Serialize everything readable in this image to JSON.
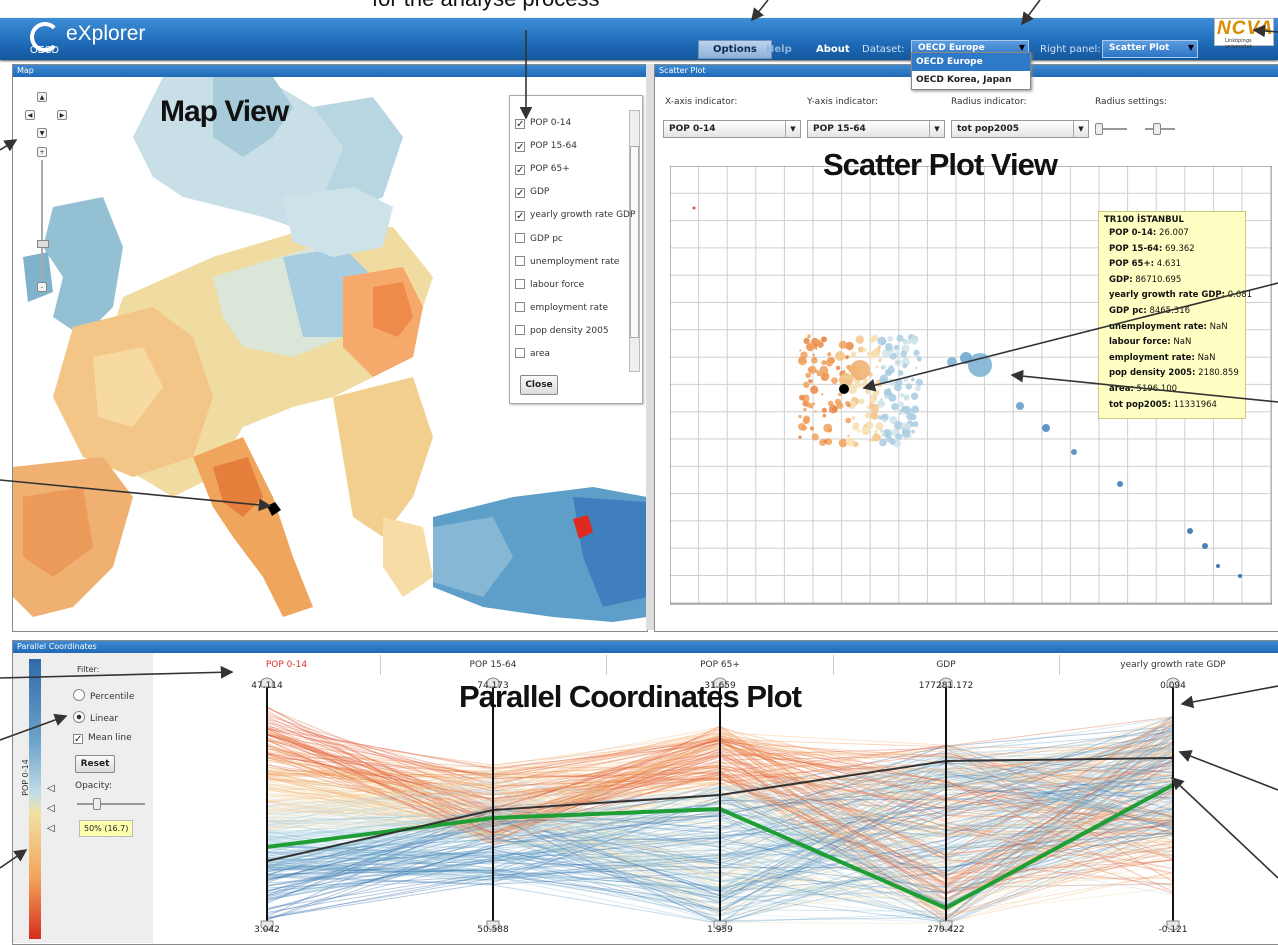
{
  "caption": "for the analyse process",
  "app": {
    "logo_text": "OECD",
    "title": "eXplorer"
  },
  "menu": {
    "options": "Options",
    "greyed": "Help",
    "about": "About",
    "dataset_label": "Dataset:",
    "dataset_value": "OECD Europe",
    "right_panel_label": "Right panel:",
    "right_panel_value": "Scatter Plot"
  },
  "dataset_options": [
    "OECD Europe",
    "OECD Korea, Japan"
  ],
  "brand": {
    "name": "NCVA",
    "subtitle": "Linköpings universitet"
  },
  "colors": {
    "accent": "#2f79c9",
    "mean_line": "#1f9e36",
    "selected_line": "#333333",
    "highlight_region": "#e02a1e"
  },
  "map": {
    "panel_title": "Map",
    "view_title": "Map View",
    "indicators": [
      {
        "label": "POP 0-14",
        "checked": true
      },
      {
        "label": "POP 15-64",
        "checked": true
      },
      {
        "label": "POP 65+",
        "checked": true
      },
      {
        "label": "GDP",
        "checked": true
      },
      {
        "label": "yearly growth rate GDP",
        "checked": true
      },
      {
        "label": "GDP pc",
        "checked": false
      },
      {
        "label": "unemployment rate",
        "checked": false
      },
      {
        "label": "labour force",
        "checked": false
      },
      {
        "label": "employment rate",
        "checked": false
      },
      {
        "label": "pop density 2005",
        "checked": false
      },
      {
        "label": "area",
        "checked": false
      }
    ],
    "close_label": "Close",
    "zoom_in": "+",
    "zoom_out": "-"
  },
  "scatter": {
    "panel_title": "Scatter Plot",
    "view_title": "Scatter Plot View",
    "x_label": "X-axis indicator:",
    "y_label": "Y-axis indicator:",
    "r_label": "Radius indicator:",
    "rs_label": "Radius settings:",
    "x_value": "POP 0-14",
    "y_value": "POP 15-64",
    "r_value": "tot pop2005"
  },
  "tooltip": {
    "title": "TR100 İSTANBUL",
    "rows": [
      {
        "k": "POP 0-14:",
        "v": "26.007"
      },
      {
        "k": "POP 15-64:",
        "v": "69.362"
      },
      {
        "k": "POP 65+:",
        "v": "4.631"
      },
      {
        "k": "GDP:",
        "v": "86710.695"
      },
      {
        "k": "yearly growth rate GDP:",
        "v": "0.081"
      },
      {
        "k": "GDP pc:",
        "v": "8465.316"
      },
      {
        "k": "unemployment rate:",
        "v": "NaN"
      },
      {
        "k": "labour force:",
        "v": "NaN"
      },
      {
        "k": "employment rate:",
        "v": "NaN"
      },
      {
        "k": "pop density 2005:",
        "v": "2180.859"
      },
      {
        "k": "area:",
        "v": "5196.100"
      },
      {
        "k": "tot pop2005:",
        "v": "11331964"
      }
    ]
  },
  "parallel": {
    "panel_title": "Parallel Coordinates",
    "view_title": "Parallel Coordinates Plot",
    "filter_label": "Filter:",
    "percentile_label": "Percentile",
    "linear_label": "Linear",
    "mean_label": "Mean line",
    "reset_label": "Reset",
    "opacity_label": "Opacity:",
    "legend_label": "POP 0-14",
    "percent_tip": "50% (16.7)",
    "axes": [
      {
        "name": "POP 0-14",
        "max": "47.114",
        "min": "3.042",
        "active": true
      },
      {
        "name": "POP 15-64",
        "max": "74.173",
        "min": "50.588",
        "active": false
      },
      {
        "name": "POP 65+",
        "max": "31.659",
        "min": "1.959",
        "active": false
      },
      {
        "name": "GDP",
        "max": "177281.172",
        "min": "270.422",
        "active": false
      },
      {
        "name": "yearly growth rate GDP",
        "max": "0.094",
        "min": "-0.121",
        "active": false
      }
    ]
  }
}
